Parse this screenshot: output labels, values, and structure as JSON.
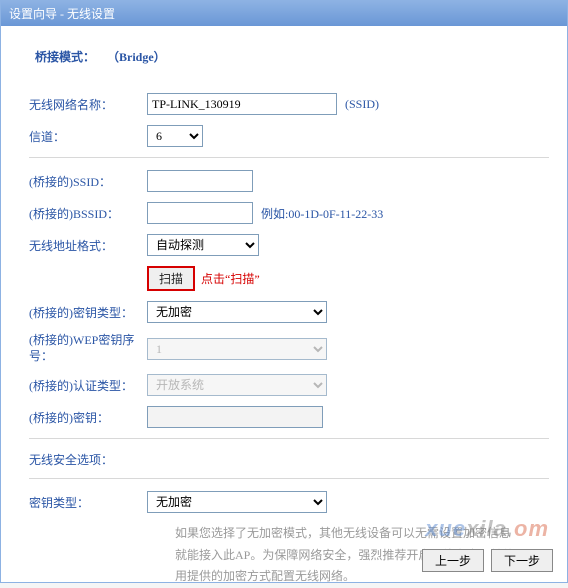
{
  "title": "设置向导 - 无线设置",
  "bridge_mode": {
    "label": "桥接模式：",
    "value": "（Bridge）"
  },
  "rows": {
    "ssid": {
      "label": "无线网络名称：",
      "value": "TP-LINK_130919",
      "after": "(SSID)"
    },
    "channel": {
      "label": "信道：",
      "value": "6"
    },
    "b_ssid": {
      "label": "(桥接的)SSID：",
      "value": ""
    },
    "b_bssid": {
      "label": "(桥接的)BSSID：",
      "value": "",
      "example": "例如:00-1D-0F-11-22-33"
    },
    "addr_fmt": {
      "label": "无线地址格式：",
      "value": "自动探测"
    },
    "scan": {
      "button": "扫描",
      "hint": "点击“扫描”"
    },
    "key_type": {
      "label": "(桥接的)密钥类型：",
      "value": "无加密"
    },
    "wep_idx": {
      "label": "(桥接的)WEP密钥序号：",
      "value": "1"
    },
    "auth_type": {
      "label": "(桥接的)认证类型：",
      "value": "开放系统"
    },
    "key": {
      "label": "(桥接的)密钥：",
      "value": ""
    },
    "sec_opt": {
      "label": "无线安全选项："
    },
    "enc_type": {
      "label": "密钥类型：",
      "value": "无加密"
    }
  },
  "help_text": "如果您选择了无加密模式，其他无线设备可以无需设置加密信息就能接入此AP。为保障网络安全，强烈推荐开启无线安全，并使用提供的加密方式配置无线网络。",
  "footer": {
    "prev": "上一步",
    "next": "下一步"
  },
  "watermark": {
    "p1": "xue",
    "p2": "xila.",
    "p3": "om"
  }
}
